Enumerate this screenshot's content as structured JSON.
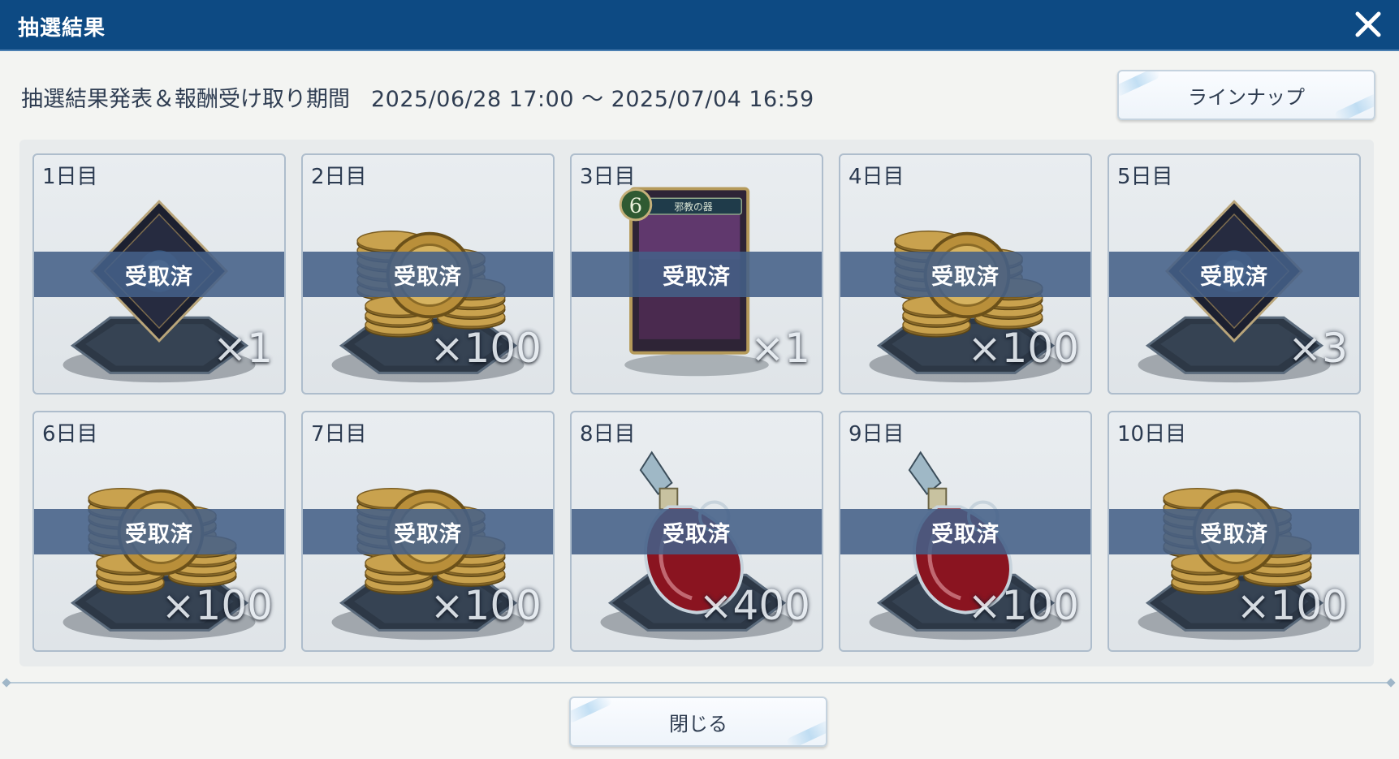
{
  "window": {
    "title": "抽選結果"
  },
  "period": {
    "label": "抽選結果発表＆報酬受け取り期間",
    "dates": "2025/06/28 17:00 ～ 2025/07/04 16:59"
  },
  "buttons": {
    "lineup": "ラインナップ",
    "close": "閉じる"
  },
  "rewards": [
    {
      "day": "1日目",
      "item": "diamond-ticket",
      "status": "受取済",
      "qty": "×1"
    },
    {
      "day": "2日目",
      "item": "coins",
      "status": "受取済",
      "qty": "×100"
    },
    {
      "day": "3日目",
      "item": "card",
      "status": "受取済",
      "qty": "×1",
      "card_cost": "6",
      "card_name": "邪教の器"
    },
    {
      "day": "4日目",
      "item": "coins",
      "status": "受取済",
      "qty": "×100"
    },
    {
      "day": "5日目",
      "item": "diamond-ticket",
      "status": "受取済",
      "qty": "×3"
    },
    {
      "day": "6日目",
      "item": "coins",
      "status": "受取済",
      "qty": "×100"
    },
    {
      "day": "7日目",
      "item": "coins",
      "status": "受取済",
      "qty": "×100"
    },
    {
      "day": "8日目",
      "item": "potion",
      "status": "受取済",
      "qty": "×400"
    },
    {
      "day": "9日目",
      "item": "potion",
      "status": "受取済",
      "qty": "×100"
    },
    {
      "day": "10日目",
      "item": "coins",
      "status": "受取済",
      "qty": "×100"
    }
  ],
  "colors": {
    "titlebar": "#0d4a83",
    "band": "#446088",
    "card_border": "#aebdcc"
  }
}
